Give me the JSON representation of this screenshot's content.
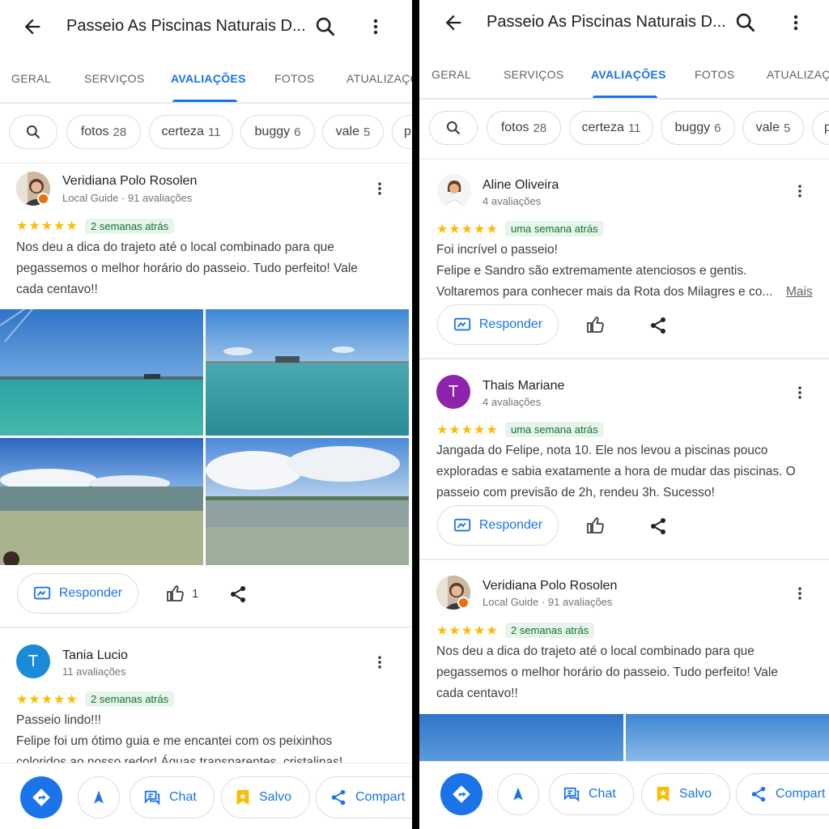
{
  "place_title": "Passeio As Piscinas Naturais D...",
  "tabs": [
    "GERAL",
    "SERVIÇOS",
    "AVALIAÇÕES",
    "FOTOS",
    "ATUALIZAÇÕ"
  ],
  "active_tab": "AVALIAÇÕES",
  "chips": [
    {
      "label": "fotos",
      "count": "28"
    },
    {
      "label": "certeza",
      "count": "11"
    },
    {
      "label": "buggy",
      "count": "6"
    },
    {
      "label": "vale",
      "count": "5"
    },
    {
      "label": "p",
      "count": ""
    }
  ],
  "reviews": {
    "veridiana": {
      "name": "Veridiana Polo Rosolen",
      "meta": "Local Guide · 91 avaliações",
      "date": "2 semanas atrás",
      "text": "Nos deu a dica do trajeto até o local combinado para que pegassemos o melhor horário do passeio. Tudo perfeito! Vale cada centavo!!",
      "likes": "1"
    },
    "tania": {
      "initial": "T",
      "name": "Tania Lucio",
      "meta": "11 avaliações",
      "date": "2 semanas atrás",
      "line1": "Passeio lindo!!!",
      "line2": "Felipe foi um ótimo guia e me encantei com os peixinhos coloridos ao nosso redor! Águas transparentes, cristalinas!"
    },
    "aline": {
      "name": "Aline Oliveira",
      "meta": "4 avaliações",
      "date": "uma semana atrás",
      "line1": "Foi incrível o passeio!",
      "line2": "Felipe e Sandro são extremamente atenciosos e gentis.",
      "line3": "Voltaremos para conhecer mais da Rota dos Milagres e co...",
      "more": "Mais"
    },
    "thais": {
      "initial": "T",
      "name": "Thais Mariane",
      "meta": "4 avaliações",
      "date": "uma semana atrás",
      "text": "Jangada do Felipe, nota 10. Ele nos levou a piscinas pouco exploradas e sabia exatamente a hora de mudar das piscinas. O passeio com previsão de 2h, rendeu 3h. Sucesso!"
    }
  },
  "reply_label": "Responder",
  "bottom": {
    "chat": "Chat",
    "saved": "Salvo",
    "share": "Compart"
  },
  "colors": {
    "accent": "#1a73e8",
    "star": "#fbbc04",
    "badge_bg": "#e6f4ea",
    "badge_text": "#137333",
    "avatar_tania": "#1a8bd6",
    "avatar_thais": "#8e24aa"
  }
}
